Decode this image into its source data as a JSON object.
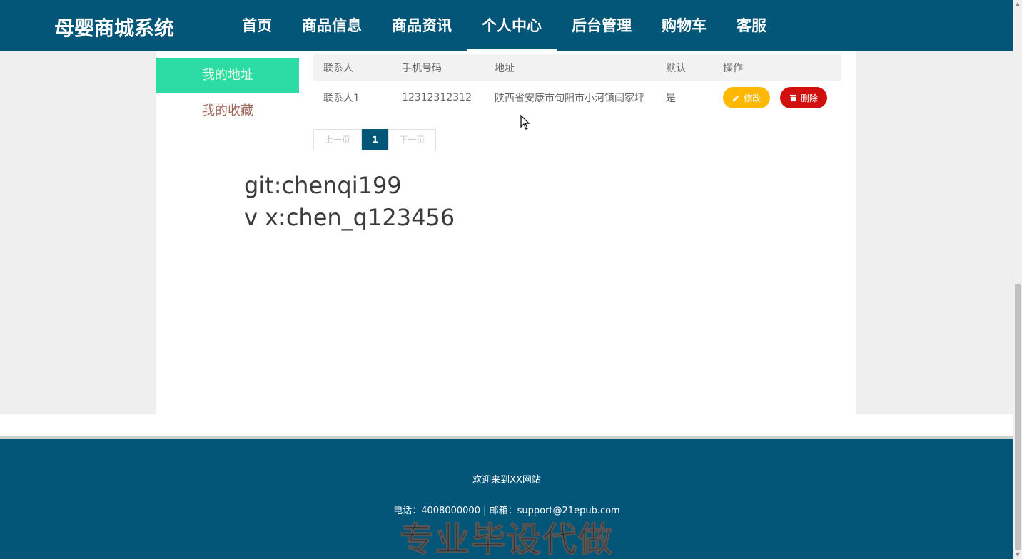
{
  "header": {
    "brand": "母婴商城系统",
    "nav": [
      "首页",
      "商品信息",
      "商品资讯",
      "个人中心",
      "后台管理",
      "购物车",
      "客服"
    ],
    "active_index": 3
  },
  "sidebar": {
    "items": [
      {
        "label": "我的地址",
        "active": true
      },
      {
        "label": "我的收藏",
        "active": false
      }
    ]
  },
  "table": {
    "headers": [
      "联系人",
      "手机号码",
      "地址",
      "默认",
      "操作"
    ],
    "rows": [
      {
        "contact": "联系人1",
        "phone": "12312312312",
        "address": "陕西省安康市旬阳市小河镇闫家坪",
        "default": "是"
      }
    ],
    "edit_label": "修改",
    "delete_label": "删除"
  },
  "pager": {
    "prev": "上一页",
    "current": "1",
    "next": "下一页"
  },
  "overlay": {
    "line1": "git:chenqi199",
    "line2": "v x:chen_q123456"
  },
  "footer": {
    "welcome": "欢迎来到XX网站",
    "contact": "电话：4008000000 | 邮箱：support@21epub.com",
    "promo": "专业毕设代做"
  },
  "colors": {
    "header_bg": "#035678",
    "sidebar_active": "#2ddca4",
    "edit_button": "#ffb800",
    "delete_button": "#d10f0f"
  }
}
